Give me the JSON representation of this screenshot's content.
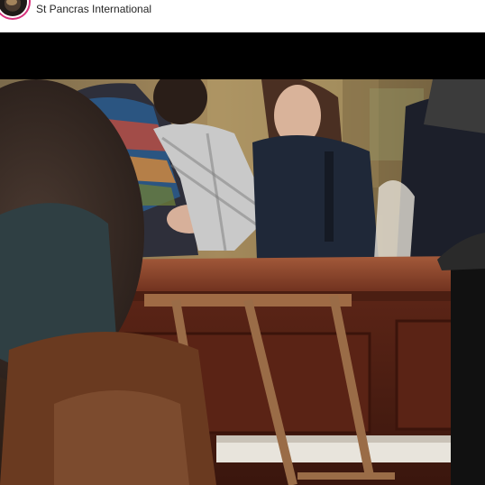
{
  "header": {
    "location": "St Pancras International"
  },
  "post": {
    "media_type": "video",
    "avatar_icon": "profile-avatar",
    "colors": {
      "letterbox": "#000000",
      "piano_wood": "#6b2e1c",
      "accent_ring": "#d8327d"
    }
  }
}
